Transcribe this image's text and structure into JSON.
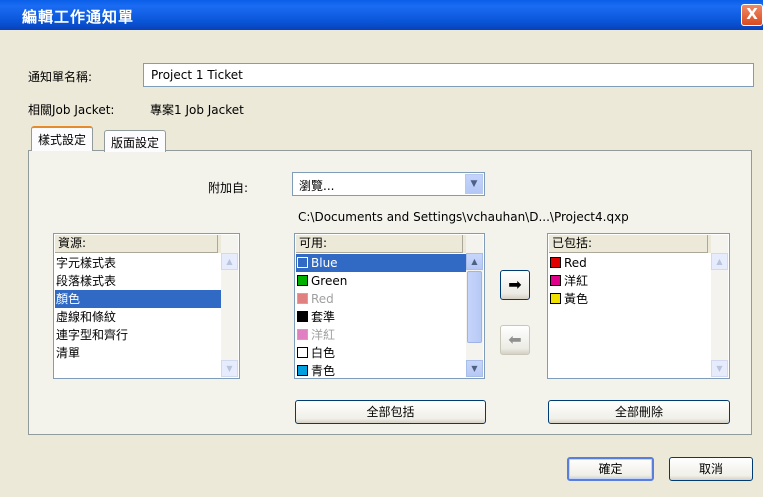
{
  "window": {
    "title": "編輯工作通知單",
    "close_glyph": "X"
  },
  "form": {
    "ticket_name_label": "通知單名稱:",
    "ticket_name_value": "Project 1 Ticket",
    "job_jacket_label": "相關Job Jacket:",
    "job_jacket_value": "專案1 Job Jacket"
  },
  "tabs": [
    {
      "label": "樣式設定",
      "active": true
    },
    {
      "label": "版面設定",
      "active": false
    }
  ],
  "append_from": {
    "label": "附加自:",
    "selected": "瀏覽...",
    "path": "C:\\Documents and Settings\\vchauhan\\D...\\Project4.qxp"
  },
  "resources": {
    "header": "資源:",
    "items": [
      "字元樣式表",
      "段落樣式表",
      "顏色",
      "虛線和條紋",
      "連字型和齊行",
      "清單"
    ],
    "selected_index": 2
  },
  "available": {
    "header": "可用:",
    "items": [
      {
        "label": "Blue",
        "color": "#2f5bd0",
        "swatch_style": "outline-white",
        "selected": true,
        "dim": false
      },
      {
        "label": "Green",
        "color": "#00b000",
        "selected": false,
        "dim": false
      },
      {
        "label": "Red",
        "color": "#e08080",
        "selected": false,
        "dim": true
      },
      {
        "label": "套準",
        "color": "#000000",
        "selected": false,
        "dim": false
      },
      {
        "label": "洋紅",
        "color": "#e080c0",
        "selected": false,
        "dim": true
      },
      {
        "label": "白色",
        "color": "#ffffff",
        "selected": false,
        "dim": false
      },
      {
        "label": "青色",
        "color": "#00a0e0",
        "selected": false,
        "dim": false
      }
    ],
    "scroll_fraction": 0.0
  },
  "included": {
    "header": "已包括:",
    "items": [
      {
        "label": "Red",
        "color": "#e00000"
      },
      {
        "label": "洋紅",
        "color": "#e0008c"
      },
      {
        "label": "黃色",
        "color": "#f0e000"
      }
    ]
  },
  "buttons": {
    "include_all": "全部包括",
    "delete_all": "全部刪除",
    "ok": "確定",
    "cancel": "取消",
    "add_arrow_glyph": "➡",
    "remove_arrow_glyph": "⬅"
  }
}
